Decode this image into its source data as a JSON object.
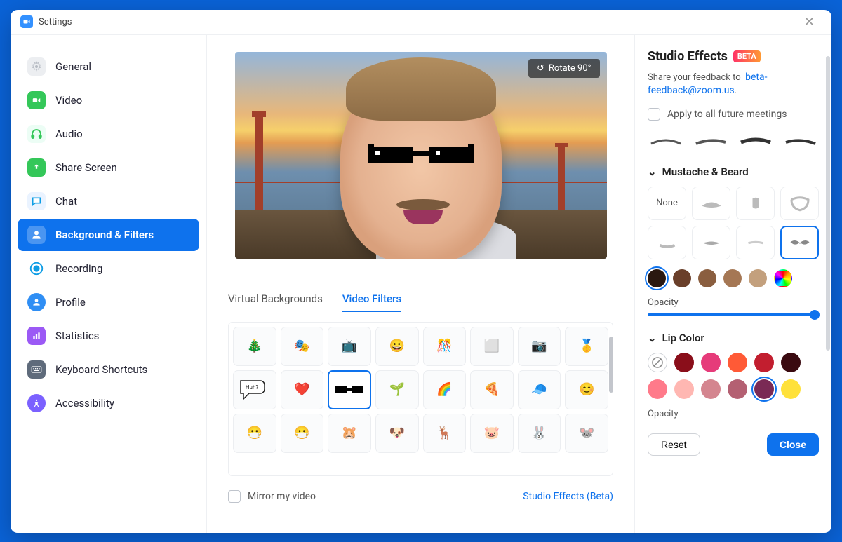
{
  "title": "Settings",
  "sidebar": {
    "items": [
      {
        "label": "General"
      },
      {
        "label": "Video"
      },
      {
        "label": "Audio"
      },
      {
        "label": "Share Screen"
      },
      {
        "label": "Chat"
      },
      {
        "label": "Background & Filters"
      },
      {
        "label": "Recording"
      },
      {
        "label": "Profile"
      },
      {
        "label": "Statistics"
      },
      {
        "label": "Keyboard Shortcuts"
      },
      {
        "label": "Accessibility"
      }
    ],
    "active_index": 5
  },
  "center": {
    "rotate_label": "Rotate 90°",
    "tabs": [
      {
        "label": "Virtual Backgrounds"
      },
      {
        "label": "Video Filters"
      }
    ],
    "active_tab": 1,
    "filter_thumbs": [
      "🎄",
      "🎭",
      "📺",
      "😀",
      "🎊",
      "⬜",
      "📷",
      "🥇",
      "💬",
      "❤️",
      "🕶️",
      "🌱",
      "🌈",
      "🍕",
      "🧢",
      "😊",
      "😷",
      "😷",
      "🐹",
      "🐶",
      "🦌",
      "🐷",
      "🐰",
      "🐭"
    ],
    "selected_filter_index": 10,
    "huh_label": "Huh?",
    "mirror_label": "Mirror my video",
    "studio_link": "Studio Effects (Beta)"
  },
  "right": {
    "heading": "Studio Effects",
    "beta": "BETA",
    "feedback_text": "Share your feedback to",
    "feedback_email": "beta-feedback@zoom.us",
    "apply_all_label": "Apply to all future meetings",
    "mustache_heading": "Mustache & Beard",
    "none_label": "None",
    "selected_mustache_index": 7,
    "shade_swatches": [
      "#2a1810",
      "#6a3f2a",
      "#8a5e3f",
      "#a57754",
      "#c3a07d"
    ],
    "selected_shade_index": 0,
    "opacity_label": "Opacity",
    "lip_heading": "Lip Color",
    "lip_colors": [
      "none",
      "#8a0e1a",
      "#e63b7a",
      "#ff5a36",
      "#c21e2f",
      "#3a0a10",
      "#ff7a8a",
      "#ffb7b2",
      "#d4858f",
      "#b46072",
      "#7a2a55",
      "#ffe13a"
    ],
    "selected_lip_index": 10,
    "reset_label": "Reset",
    "close_label": "Close"
  }
}
